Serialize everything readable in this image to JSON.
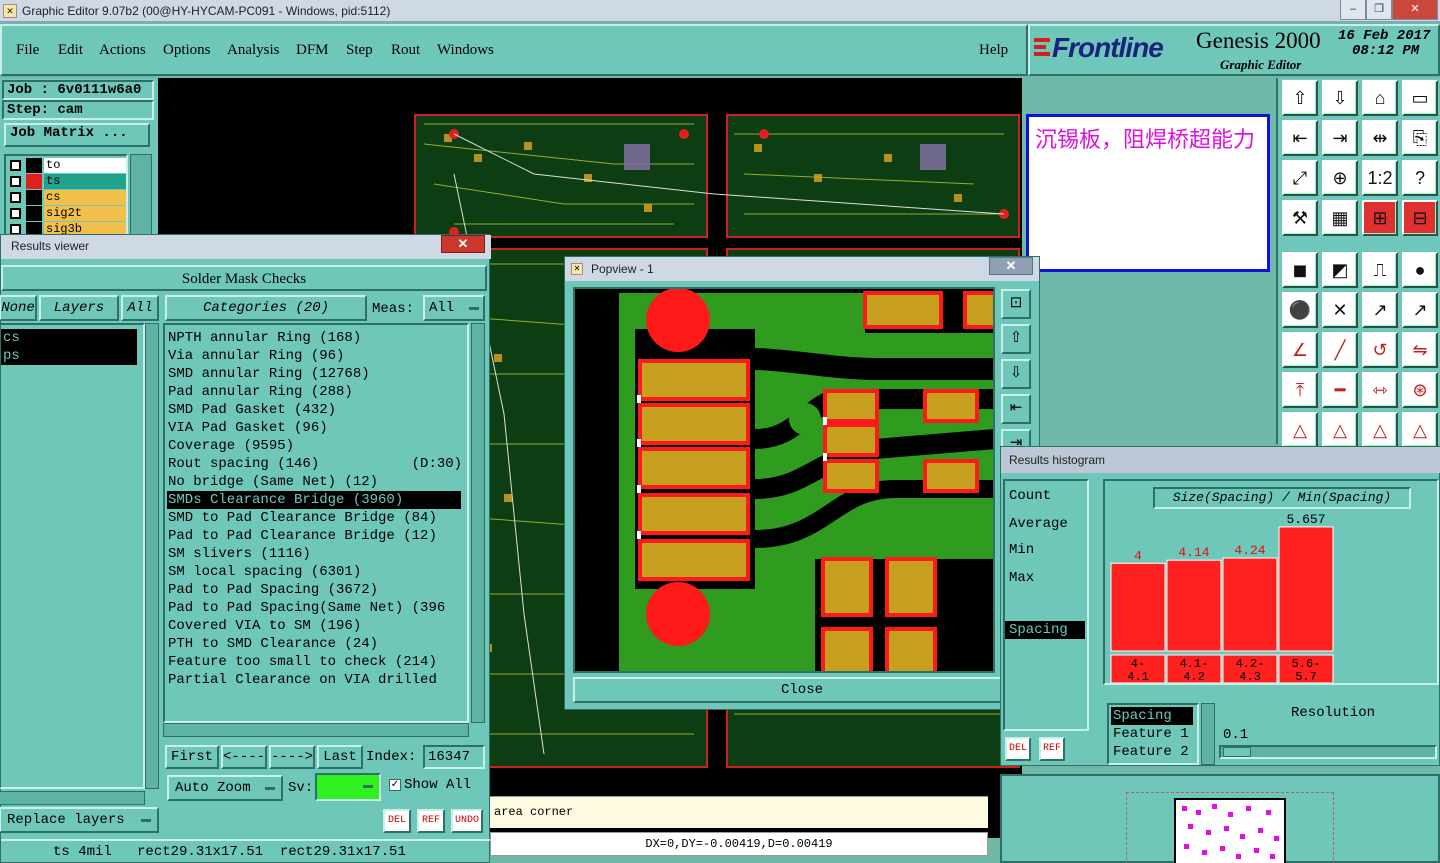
{
  "window": {
    "title": "Graphic Editor 9.07b2 (00@HY-HYCAM-PC091 - Windows, pid:5112)",
    "min": "‒",
    "restore": "❐",
    "close": "✕"
  },
  "menu": [
    "File",
    "Edit",
    "Actions",
    "Options",
    "Analysis",
    "DFM",
    "Step",
    "Rout",
    "Windows"
  ],
  "help": "Help",
  "brand": {
    "logo": "Frontline",
    "product": "Genesis 2000",
    "sub": "Graphic Editor",
    "date": "16 Feb 2017",
    "time": "08:12 PM"
  },
  "job": {
    "job": "Job : 6v0111w6a0",
    "step": "Step: cam",
    "matrix": "Job Matrix ..."
  },
  "layers": [
    {
      "name": "to",
      "color": "#ffffff",
      "mark": "#000000"
    },
    {
      "name": "ts",
      "color": "#1fa38a",
      "mark": "#e02020"
    },
    {
      "name": "cs",
      "color": "#f2c04a",
      "mark": "#000000"
    },
    {
      "name": "sig2t",
      "color": "#f2c04a",
      "mark": "#000000"
    },
    {
      "name": "sig3b",
      "color": "#f2c04a",
      "mark": "#000000"
    }
  ],
  "note": "沉锡板，阻焊桥超能力",
  "results": {
    "title": "Results viewer",
    "header": "Solder Mask Checks",
    "none": "None",
    "layers_label": "Layers",
    "all": "All",
    "categories_label": "Categories (20)",
    "meas_label": "Meas:",
    "meas_value": "All",
    "layer_list": [
      "cs",
      "ps"
    ],
    "categories": [
      "NPTH annular Ring (168)",
      "Via annular Ring (96)",
      "SMD annular Ring (12768)",
      "Pad annular Ring (288)",
      "SMD Pad Gasket (432)",
      "VIA Pad Gasket (96)",
      "Coverage (9595)",
      "Rout spacing (146)           (D:30)",
      "No bridge (Same Net) (12)",
      "SMDs Clearance Bridge (3960)",
      "SMD to Pad Clearance Bridge (84)",
      "Pad to Pad Clearance Bridge (12)",
      "SM slivers (1116)",
      "SM local spacing (6301)",
      "Pad to Pad Spacing (3672)",
      "Pad to Pad Spacing(Same Net) (396",
      "Covered VIA to SM (196)",
      "PTH to SMD Clearance (24)",
      "Feature too small to check (214)",
      "Partial Clearance on VIA drilled"
    ],
    "selected_index": 9,
    "first": "First",
    "prev": "<----",
    "next": "---->",
    "last": "Last",
    "index_label": "Index:",
    "index_value": "16347",
    "autozoom": "Auto Zoom",
    "sv_label": "Sv:",
    "show_all": "Show All",
    "replace": "Replace layers",
    "del": "DEL",
    "ref": "REF",
    "undo": "UNDO"
  },
  "popview": {
    "title": "Popview - 1",
    "close": "Close"
  },
  "status": {
    "left": "ts 4mil   rect29.31x17.51  rect29.31x17.51",
    "hint": "area corner",
    "delta": "DX=0,DY=-0.00419,D=0.00419"
  },
  "histogram": {
    "title": "Results histogram",
    "side": [
      "Count",
      "Average",
      "Min",
      "Max",
      "Spacing"
    ],
    "del": "DEL",
    "ref": "REF",
    "spacing_label": "Spacing",
    "feature1": "Feature 1",
    "feature2": "Feature 2",
    "resolution_label": "Resolution",
    "resolution_value": "0.1",
    "chart_title": "Size(Spacing) / Min(Spacing)"
  },
  "chart_data": {
    "type": "bar",
    "title": "Size(Spacing) / Min(Spacing)",
    "categories": [
      "4-4.1",
      "4.1-4.2",
      "4.2-4.3",
      "5.6-5.7"
    ],
    "category_lines": [
      [
        "4-",
        "4.1"
      ],
      [
        "4.1-",
        "4.2"
      ],
      [
        "4.2-",
        "4.3"
      ],
      [
        "5.6-",
        "5.7"
      ]
    ],
    "values": [
      4,
      4.14,
      4.24,
      5.657
    ],
    "labels": [
      "4",
      "4.14",
      "4.24",
      "5.657"
    ],
    "color": "#ff2020"
  }
}
